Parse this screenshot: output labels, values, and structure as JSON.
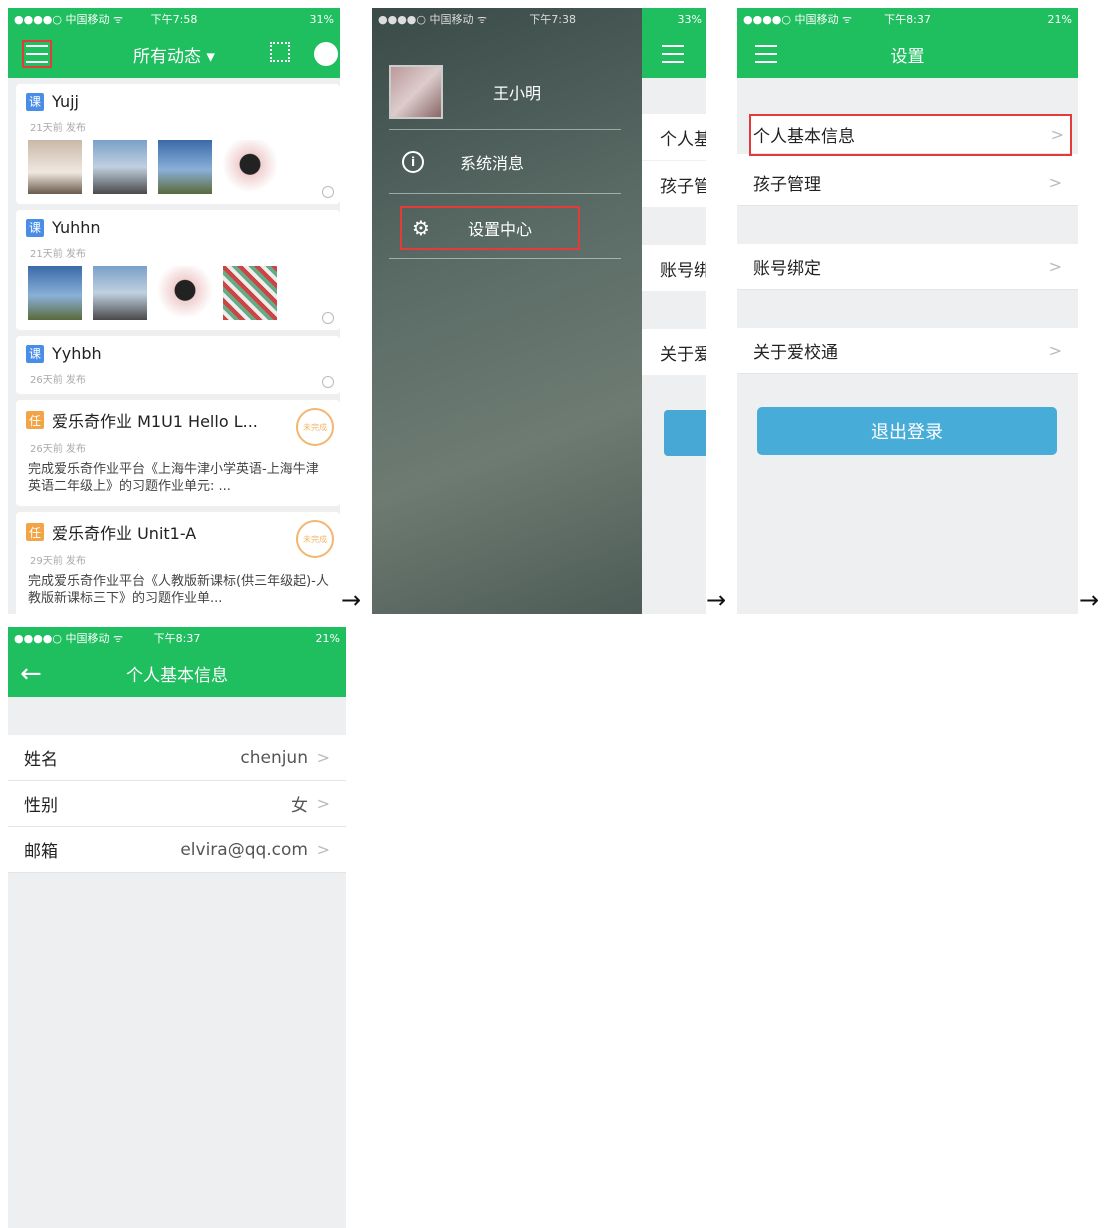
{
  "screen1": {
    "status": {
      "carrier": "●●●●○ 中国移动 ᯤ",
      "time": "下午7:58",
      "battery": "31%"
    },
    "title": "所有动态 ▾",
    "cards": [
      {
        "tag": "课",
        "title": "Yujj",
        "meta": "21天前 发布"
      },
      {
        "tag": "课",
        "title": "Yuhhn",
        "meta": "21天前 发布"
      },
      {
        "tag": "课",
        "title": "Yyhbh",
        "meta": "26天前 发布"
      },
      {
        "tag": "任",
        "title": "爱乐奇作业 M1U1 Hello L...",
        "meta": "26天前 发布",
        "desc": "完成爱乐奇作业平台《上海牛津小学英语-上海牛津英语二年级上》的习题作业单元: ...",
        "stamp": "未完成"
      },
      {
        "tag": "任",
        "title": "爱乐奇作业 Unit1-A",
        "meta": "29天前 发布",
        "desc": "完成爱乐奇作业平台《人教版新课标(供三年级起)-人教版新课标三下》的习题作业单...",
        "stamp": "未完成"
      }
    ]
  },
  "screen2": {
    "status": {
      "carrier": "●●●●○ 中国移动 ᯤ",
      "time": "下午7:38",
      "battery": "33%"
    },
    "username": "王小明",
    "menu": [
      {
        "label": "系统消息",
        "icon": "i"
      },
      {
        "label": "设置中心",
        "icon": "⚙"
      }
    ],
    "peek": [
      "个人基",
      "孩子管",
      "账号绑",
      "关于爱"
    ]
  },
  "screen3": {
    "status": {
      "carrier": "●●●●○ 中国移动 ᯤ",
      "time": "下午8:37",
      "battery": "21%"
    },
    "title": "设置",
    "rows": [
      "个人基本信息",
      "孩子管理",
      "账号绑定",
      "关于爱校通"
    ],
    "logout": "退出登录"
  },
  "screen4": {
    "status": {
      "carrier": "●●●●○ 中国移动 ᯤ",
      "time": "下午8:37",
      "battery": "21%"
    },
    "title": "个人基本信息",
    "fields": [
      {
        "label": "姓名",
        "value": "chenjun"
      },
      {
        "label": "性别",
        "value": "女"
      },
      {
        "label": "邮箱",
        "value": "elvira@qq.com"
      }
    ]
  },
  "arrow": "→",
  "colors": {
    "green": "#1fbe5e",
    "blue": "#47acd8",
    "highlight": "#e33b3b"
  }
}
